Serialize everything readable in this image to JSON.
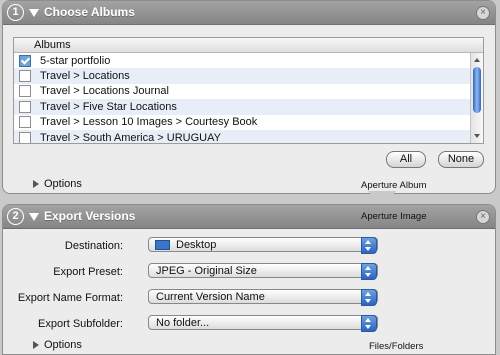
{
  "choose_albums": {
    "step": "1",
    "title": "Choose Albums",
    "list_header": "Albums",
    "rows": [
      {
        "label": "5-star portfolio",
        "checked": true
      },
      {
        "label": "Travel > Locations",
        "checked": false
      },
      {
        "label": "Travel > Locations Journal",
        "checked": false
      },
      {
        "label": "Travel > Five Star Locations",
        "checked": false
      },
      {
        "label": "Travel > Lesson 10 Images > Courtesy Book",
        "checked": false
      },
      {
        "label": "Travel > South America > URUGUAY",
        "checked": false
      }
    ],
    "all_label": "All",
    "none_label": "None",
    "options_label": "Options",
    "footer_label": "Aperture Album"
  },
  "export_versions": {
    "step": "2",
    "title": "Export Versions",
    "header_sub": "Aperture Image",
    "fields": [
      {
        "label": "Destination:",
        "value": "Desktop",
        "icon": "folder-icon"
      },
      {
        "label": "Export Preset:",
        "value": "JPEG - Original Size"
      },
      {
        "label": "Export Name Format:",
        "value": "Current Version Name"
      },
      {
        "label": "Export Subfolder:",
        "value": "No folder..."
      }
    ],
    "options_label": "Options",
    "footer_label": "Files/Folders"
  },
  "colors": {
    "header": "#8f8f8f",
    "panel": "#ececec",
    "accent": "#2b63c2"
  }
}
